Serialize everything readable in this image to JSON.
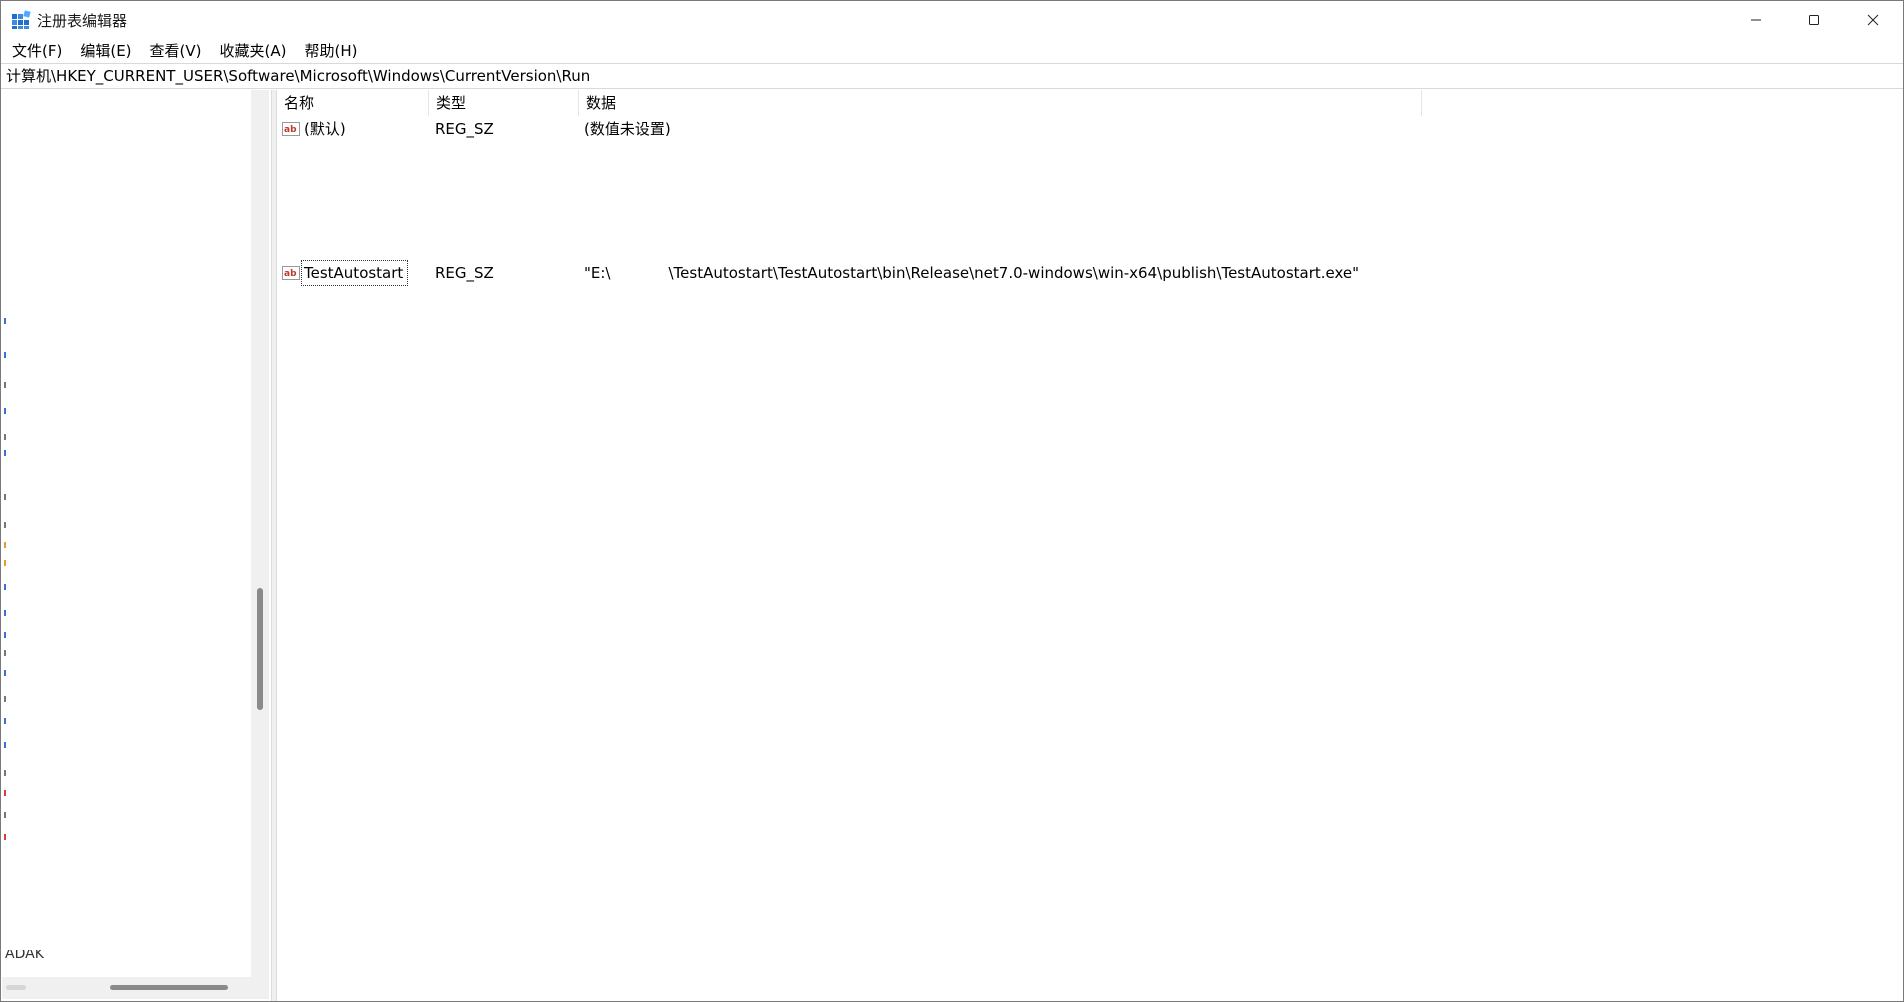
{
  "window": {
    "title": "注册表编辑器",
    "app_icon": "registry-editor-icon"
  },
  "menu": [
    {
      "label": "文件(F)"
    },
    {
      "label": "编辑(E)"
    },
    {
      "label": "查看(V)"
    },
    {
      "label": "收藏夹(A)"
    },
    {
      "label": "帮助(H)"
    }
  ],
  "address": {
    "path": "计算机\\HKEY_CURRENT_USER\\Software\\Microsoft\\Windows\\CurrentVersion\\Run"
  },
  "tree": {
    "bottom_text": "ADAK"
  },
  "list": {
    "columns": [
      "名称",
      "类型",
      "数据"
    ],
    "rows": [
      {
        "icon": "string-value-icon",
        "name": "(默认)",
        "type": "REG_SZ",
        "data": "(数值未设置)"
      },
      {
        "icon": "string-value-icon",
        "name": "TestAutostart",
        "type": "REG_SZ",
        "data_prefix": "\"E:\\",
        "data_suffix": "\\TestAutostart\\TestAutostart\\bin\\Release\\net7.0-windows\\win-x64\\publish\\TestAutostart.exe\""
      }
    ]
  },
  "colors": {
    "accent": "#0067c0",
    "scrollbar_thumb": "#8a8a8a",
    "pane_background": "#f0f0f0"
  }
}
